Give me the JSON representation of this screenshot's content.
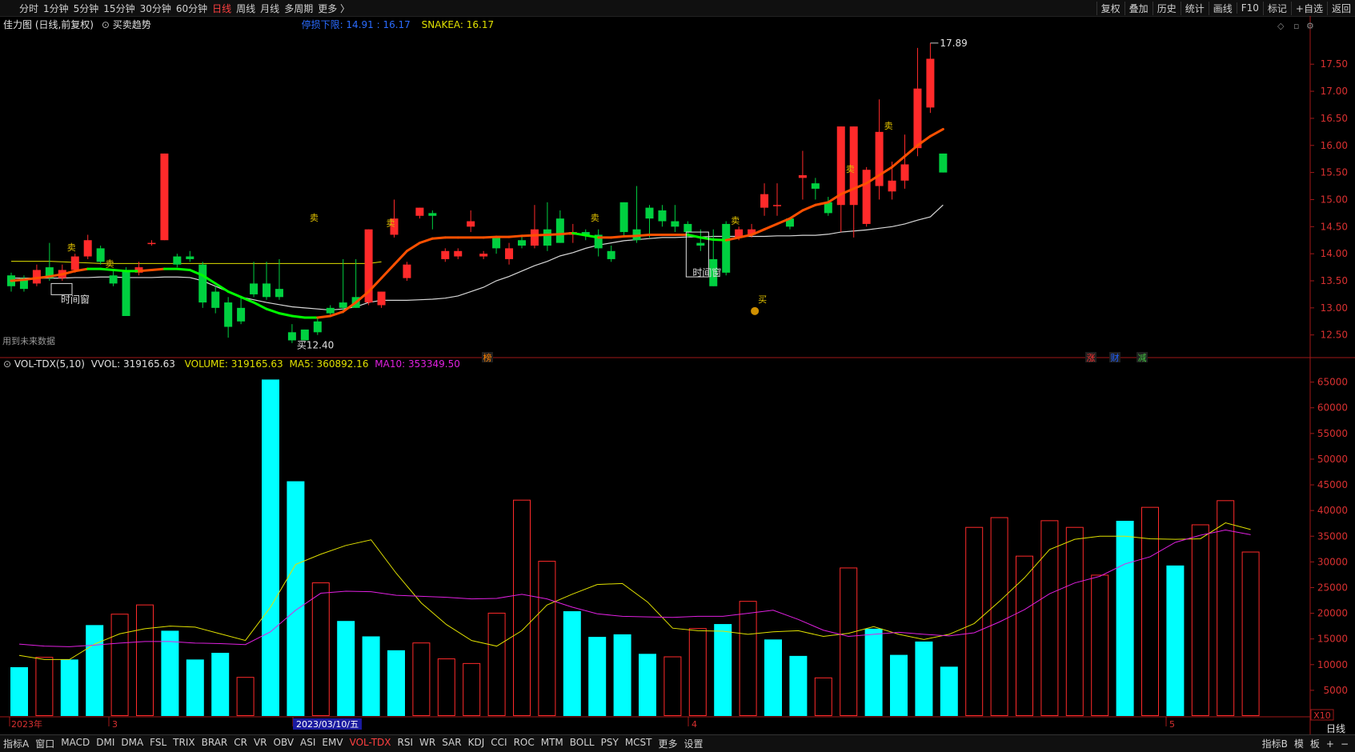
{
  "toolbar": {
    "periods": [
      "分时",
      "1分钟",
      "5分钟",
      "15分钟",
      "30分钟",
      "60分钟",
      "日线",
      "周线",
      "月线",
      "多周期",
      "更多 〉"
    ],
    "active_period": "日线",
    "actions": [
      "复权",
      "叠加",
      "历史",
      "统计",
      "画线",
      "F10",
      "标记",
      "+自选",
      "返回"
    ]
  },
  "main_panel": {
    "title": "佳力图 (日线,前复权)",
    "indicator": "买卖趋势",
    "legend_1": "停损下限: 14.91 : 16.17",
    "legend_2": "SNAKEA: 16.17",
    "note": "用到未来数据",
    "high_label": "17.89",
    "low_label": "买12.40",
    "window_label_1": "时间窗",
    "window_label_2": "时间窗",
    "buy_label": "买",
    "sell_label": "卖",
    "markers": [
      "榜",
      "涨",
      "财",
      "减"
    ]
  },
  "volume_panel": {
    "title": "VOL-TDX(5,10)",
    "vvol": "VVOL: 319165.63",
    "volume": "VOLUME: 319165.63",
    "ma5": "MA5: 360892.16",
    "ma10": "MA10: 353349.50",
    "scale_label": "X10"
  },
  "date_axis": {
    "labels": [
      "2023年",
      "3",
      "2023/03/10/五",
      "4",
      "5"
    ]
  },
  "bottom_bar": {
    "left": [
      "指标A",
      "窗口"
    ],
    "indicators": [
      "MACD",
      "DMI",
      "DMA",
      "FSL",
      "TRIX",
      "BRAR",
      "CR",
      "VR",
      "OBV",
      "ASI",
      "EMV",
      "VOL-TDX",
      "RSI",
      "WR",
      "SAR",
      "KDJ",
      "CCI",
      "ROC",
      "MTM",
      "BOLL",
      "PSY",
      "MCST",
      "更多",
      "设置"
    ],
    "active_indicator": "VOL-TDX",
    "right": [
      "指标B",
      "模",
      "板",
      "+",
      "−"
    ],
    "period_label": "日线"
  },
  "colors": {
    "up": "#ff2a2a",
    "down": "#00d040",
    "vol_down": "#00ffff",
    "ma5": "#e0e000",
    "ma10": "#e020e0",
    "trend_down": "#00ff00",
    "trend_up": "#ff5000",
    "white_line": "#d8d8d8"
  },
  "chart_data": [
    {
      "type": "candlestick",
      "title": "佳力图 (日线,前复权)",
      "y_ticks": [
        12.5,
        13.0,
        13.5,
        14.0,
        14.5,
        15.0,
        15.5,
        16.0,
        16.5,
        17.0,
        17.5
      ],
      "ylim": [
        12.2,
        18.05
      ],
      "candles": [
        [
          13.6,
          13.4,
          13.65,
          13.3
        ],
        [
          13.55,
          13.35,
          13.6,
          13.3
        ],
        [
          13.45,
          13.7,
          13.8,
          13.4
        ],
        [
          13.75,
          13.55,
          14.2,
          13.5
        ],
        [
          13.55,
          13.7,
          13.8,
          13.5
        ],
        [
          13.7,
          13.95,
          14.0,
          13.65
        ],
        [
          13.95,
          14.25,
          14.35,
          13.9
        ],
        [
          14.1,
          13.85,
          14.15,
          13.8
        ],
        [
          13.6,
          13.45,
          13.7,
          13.4
        ],
        [
          13.7,
          12.85,
          13.75,
          12.85
        ],
        [
          13.65,
          13.75,
          13.85,
          13.6
        ],
        [
          14.2,
          14.2,
          14.25,
          14.15
        ],
        [
          14.25,
          15.85,
          15.85,
          14.25
        ],
        [
          13.95,
          13.8,
          14.0,
          13.75
        ],
        [
          13.95,
          13.9,
          14.05,
          13.85
        ],
        [
          13.8,
          13.1,
          13.85,
          13.0
        ],
        [
          13.3,
          13.0,
          13.4,
          12.9
        ],
        [
          13.1,
          12.65,
          13.2,
          12.45
        ],
        [
          13.0,
          12.75,
          13.2,
          12.7
        ],
        [
          13.45,
          13.25,
          13.85,
          13.2
        ],
        [
          13.45,
          13.2,
          13.85,
          13.15
        ],
        [
          13.35,
          13.2,
          13.9,
          13.15
        ],
        [
          12.55,
          12.4,
          12.7,
          12.35
        ],
        [
          12.6,
          12.4,
          12.6,
          12.4
        ],
        [
          12.75,
          12.55,
          12.8,
          12.5
        ],
        [
          13.0,
          12.9,
          13.05,
          12.85
        ],
        [
          13.1,
          13.0,
          13.9,
          12.9
        ],
        [
          13.2,
          13.0,
          13.9,
          13.0
        ],
        [
          13.1,
          14.45,
          14.45,
          13.05
        ],
        [
          13.05,
          13.3,
          13.3,
          13.0
        ],
        [
          14.35,
          14.65,
          15.0,
          14.3
        ],
        [
          13.55,
          13.8,
          13.85,
          13.5
        ],
        [
          14.7,
          14.85,
          14.85,
          14.65
        ],
        [
          14.75,
          14.7,
          14.8,
          14.45
        ],
        [
          13.9,
          14.05,
          14.1,
          13.85
        ],
        [
          13.95,
          14.05,
          14.1,
          13.9
        ],
        [
          14.5,
          14.6,
          14.8,
          14.4
        ],
        [
          13.95,
          14.0,
          14.05,
          13.9
        ],
        [
          14.3,
          14.1,
          14.3,
          14.0
        ],
        [
          13.9,
          14.1,
          14.2,
          13.8
        ],
        [
          14.25,
          14.15,
          14.35,
          14.1
        ],
        [
          14.15,
          14.45,
          14.9,
          14.1
        ],
        [
          14.45,
          14.15,
          14.95,
          14.05
        ],
        [
          14.65,
          14.2,
          14.8,
          14.2
        ],
        [
          14.35,
          14.4,
          14.55,
          14.2
        ],
        [
          14.4,
          14.35,
          14.45,
          14.25
        ],
        [
          14.35,
          14.1,
          14.45,
          13.95
        ],
        [
          14.05,
          13.9,
          14.15,
          13.85
        ],
        [
          14.95,
          14.4,
          14.95,
          14.3
        ],
        [
          14.45,
          14.25,
          15.25,
          14.2
        ],
        [
          14.85,
          14.65,
          14.9,
          14.3
        ],
        [
          14.8,
          14.6,
          14.9,
          14.5
        ],
        [
          14.6,
          14.5,
          14.9,
          14.4
        ],
        [
          14.55,
          14.4,
          14.6,
          14.3
        ],
        [
          14.2,
          14.15,
          14.45,
          14.05
        ],
        [
          13.9,
          13.4,
          14.45,
          13.4
        ],
        [
          14.55,
          13.65,
          14.6,
          13.6
        ],
        [
          14.3,
          14.45,
          14.5,
          14.25
        ],
        [
          14.35,
          14.45,
          14.55,
          14.3
        ],
        [
          14.85,
          15.1,
          15.3,
          14.7
        ],
        [
          14.9,
          14.9,
          15.3,
          14.7
        ],
        [
          14.65,
          14.5,
          14.65,
          14.45
        ],
        [
          15.4,
          15.45,
          15.9,
          15.0
        ],
        [
          15.3,
          15.2,
          15.4,
          15.0
        ],
        [
          14.95,
          14.75,
          15.05,
          14.7
        ],
        [
          14.9,
          16.35,
          16.35,
          14.4
        ],
        [
          14.9,
          16.35,
          16.35,
          14.3
        ],
        [
          14.55,
          15.55,
          15.6,
          14.5
        ],
        [
          15.25,
          16.25,
          16.85,
          15.0
        ],
        [
          15.15,
          15.35,
          15.7,
          15.0
        ],
        [
          15.35,
          15.65,
          16.2,
          15.2
        ],
        [
          15.95,
          17.05,
          17.8,
          15.8
        ],
        [
          16.7,
          17.6,
          17.89,
          16.6
        ],
        [
          15.85,
          15.5,
          15.85,
          15.5
        ]
      ],
      "white_line": [
        13.55,
        13.55,
        13.55,
        13.55,
        13.55,
        13.56,
        13.56,
        13.57,
        13.57,
        13.56,
        13.56,
        13.56,
        13.57,
        13.57,
        13.56,
        13.5,
        13.4,
        13.3,
        13.2,
        13.15,
        13.1,
        13.06,
        13.02,
        13.0,
        12.98,
        12.96,
        12.98,
        13.02,
        13.1,
        13.14,
        13.14,
        13.14,
        13.15,
        13.16,
        13.18,
        13.22,
        13.3,
        13.38,
        13.5,
        13.58,
        13.68,
        13.78,
        13.86,
        13.96,
        14.02,
        14.1,
        14.16,
        14.2,
        14.24,
        14.26,
        14.28,
        14.3,
        14.3,
        14.31,
        14.31,
        14.32,
        14.32,
        14.32,
        14.32,
        14.32,
        14.33,
        14.33,
        14.34,
        14.34,
        14.36,
        14.4,
        14.42,
        14.44,
        14.47,
        14.5,
        14.55,
        14.62,
        14.68,
        14.9
      ],
      "trend_line": [
        13.5,
        13.52,
        13.55,
        13.58,
        13.62,
        13.68,
        13.72,
        13.72,
        13.7,
        13.68,
        13.68,
        13.7,
        13.72,
        13.72,
        13.7,
        13.6,
        13.45,
        13.3,
        13.2,
        13.1,
        12.98,
        12.9,
        12.85,
        12.82,
        12.82,
        12.85,
        12.93,
        13.1,
        13.3,
        13.55,
        13.8,
        14.05,
        14.2,
        14.28,
        14.3,
        14.3,
        14.3,
        14.3,
        14.31,
        14.31,
        14.33,
        14.34,
        14.35,
        14.36,
        14.38,
        14.34,
        14.3,
        14.3,
        14.32,
        14.33,
        14.35,
        14.35,
        14.35,
        14.35,
        14.3,
        14.26,
        14.25,
        14.3,
        14.35,
        14.45,
        14.55,
        14.65,
        14.8,
        14.9,
        14.95,
        15.1,
        15.2,
        15.3,
        15.45,
        15.6,
        15.8,
        16.0,
        16.17,
        16.3
      ],
      "yellow_line": [
        13.86,
        13.86,
        13.86,
        13.86,
        13.85,
        13.84,
        13.83,
        13.82,
        13.82,
        13.82,
        13.82,
        13.82,
        13.82,
        13.82,
        13.82,
        13.82,
        13.82,
        13.82,
        13.82,
        13.82,
        13.82,
        13.82,
        13.82,
        13.82,
        13.82,
        13.82,
        13.82,
        13.82,
        13.82,
        13.85
      ]
    },
    {
      "type": "bar",
      "title": "VOL-TDX(5,10)",
      "y_ticks": [
        5000,
        10000,
        15000,
        20000,
        25000,
        30000,
        35000,
        40000,
        45000,
        50000,
        55000,
        60000,
        65000
      ],
      "ylim": [
        0,
        66500
      ],
      "volumes": [
        9500,
        11500,
        11000,
        17700,
        19900,
        21700,
        16600,
        11000,
        12300,
        7600,
        65500,
        45700,
        26000,
        18500,
        15500,
        12800,
        14300,
        11200,
        10300,
        20100,
        42100,
        30200,
        20400,
        15400,
        15900,
        12100,
        11600,
        17100,
        17900,
        22400,
        14900,
        11700,
        7500,
        28900,
        17000,
        11900,
        14500,
        9600,
        36800,
        38700,
        31200,
        38100,
        36800,
        27500,
        38000,
        40700,
        29300,
        37300,
        42000,
        32000
      ],
      "down_bars": [
        0,
        2,
        3,
        6,
        7,
        8,
        10,
        11,
        13,
        14,
        15,
        22,
        23,
        24,
        25,
        28,
        30,
        31,
        34,
        35,
        36,
        37,
        44,
        46
      ],
      "ma5": [
        11800,
        11000,
        11000,
        14000,
        16000,
        17000,
        17500,
        17300,
        16000,
        14700,
        21200,
        29500,
        31500,
        33200,
        34300,
        27800,
        22000,
        17800,
        14700,
        13600,
        16600,
        21600,
        23700,
        25600,
        25800,
        22200,
        17100,
        16600,
        16500,
        15900,
        16400,
        16600,
        15500,
        16100,
        17400,
        15900,
        14900,
        15900,
        18000,
        22300,
        26900,
        32400,
        34400,
        35000,
        35000,
        34500,
        34400,
        34500,
        37600,
        36300
      ],
      "ma10": [
        14000,
        13600,
        13500,
        13800,
        14200,
        14500,
        14500,
        14200,
        14100,
        13900,
        16400,
        20600,
        23900,
        24300,
        24200,
        23500,
        23300,
        23100,
        22800,
        22900,
        23700,
        22800,
        21200,
        19900,
        19400,
        19300,
        19200,
        19400,
        19400,
        20000,
        20600,
        18800,
        16700,
        15500,
        15900,
        16300,
        15900,
        15600,
        16200,
        18300,
        20700,
        23800,
        25900,
        27200,
        29600,
        31000,
        33800,
        35200,
        36200,
        35300
      ]
    }
  ]
}
